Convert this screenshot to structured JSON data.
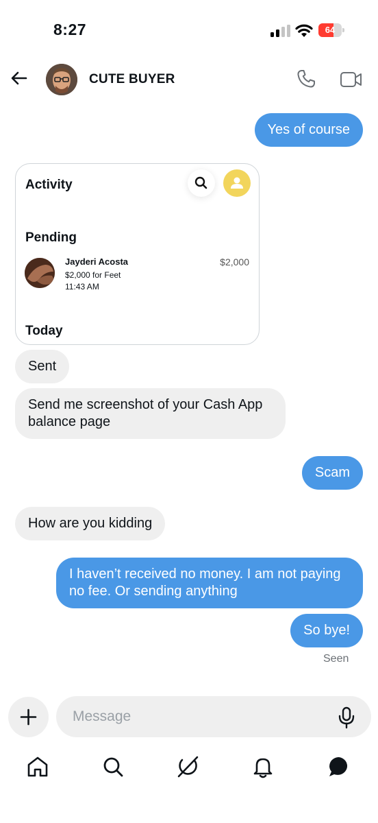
{
  "status_bar": {
    "time": "8:27",
    "battery": "64",
    "battery_level": 0.64
  },
  "header": {
    "back_icon": "arrow-left-icon",
    "contact_name": "CUTE BUYER",
    "call_icon": "phone-icon",
    "video_icon": "video-camera-icon"
  },
  "messages": [
    {
      "direction": "outgoing",
      "text": "Yes of course"
    },
    {
      "direction": "incoming",
      "type": "image",
      "attachment": "cash-app-screenshot"
    },
    {
      "direction": "incoming",
      "text": "Sent"
    },
    {
      "direction": "incoming",
      "text": "Send me screenshot of your Cash App balance page"
    },
    {
      "direction": "outgoing",
      "text": "Scam"
    },
    {
      "direction": "incoming",
      "text": "How are you kidding"
    },
    {
      "direction": "outgoing",
      "text": "I haven’t received no money. I am not paying no fee. Or sending anything"
    },
    {
      "direction": "outgoing",
      "text": "So bye!"
    }
  ],
  "screenshot_card": {
    "title": "Activity",
    "pending_heading": "Pending",
    "transaction": {
      "name": "Jayderi Acosta",
      "note": "$2,000 for Feet",
      "time": "11:43 AM",
      "amount": "$2,000"
    },
    "today_heading": "Today"
  },
  "read_receipt": "Seen",
  "composer": {
    "placeholder": "Message",
    "add_icon": "plus-icon",
    "mic_icon": "microphone-icon"
  },
  "bottom_nav": [
    "home-icon",
    "search-icon",
    "grok-icon",
    "notifications-icon",
    "messages-icon"
  ],
  "colors": {
    "outgoing_bubble": "#4a98e6",
    "incoming_bubble": "#efefef",
    "card_profile": "#f2d55c"
  }
}
